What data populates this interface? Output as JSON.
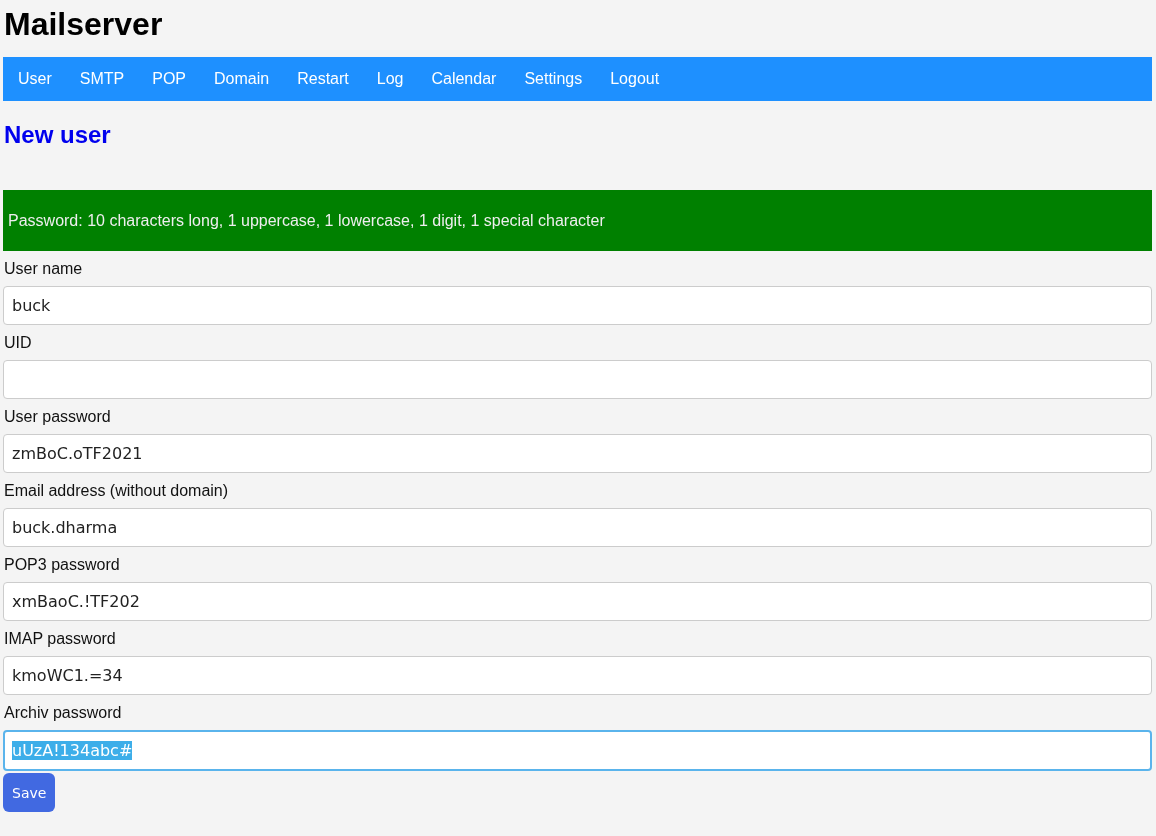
{
  "title": "Mailserver",
  "nav": [
    {
      "label": "User"
    },
    {
      "label": "SMTP"
    },
    {
      "label": "POP"
    },
    {
      "label": "Domain"
    },
    {
      "label": "Restart"
    },
    {
      "label": "Log"
    },
    {
      "label": "Calendar"
    },
    {
      "label": "Settings"
    },
    {
      "label": "Logout"
    }
  ],
  "heading": "New user",
  "notice": "Password: 10 characters long, 1 uppercase, 1 lowercase, 1 digit, 1 special character",
  "fields": [
    {
      "label": "User name",
      "value": "buck",
      "focused": false,
      "text_selected": false
    },
    {
      "label": "UID",
      "focused": false
    },
    {
      "label": "User password",
      "value": "zmBoC.oTF2021",
      "focused": false,
      "text_selected": false
    },
    {
      "label": "Email address (without domain)",
      "value": "buck.dharma",
      "focused": false,
      "text_selected": false
    },
    {
      "label": "POP3 password",
      "value": "xmBaoC.!TF202",
      "focused": false,
      "text_selected": false
    },
    {
      "label": "IMAP password",
      "value": "kmoWC1.=34",
      "focused": false,
      "text_selected": false
    },
    {
      "label": "Archiv password",
      "value": "uUzA!134abc#",
      "focused": true,
      "text_selected": true
    }
  ],
  "save_button": "Save"
}
